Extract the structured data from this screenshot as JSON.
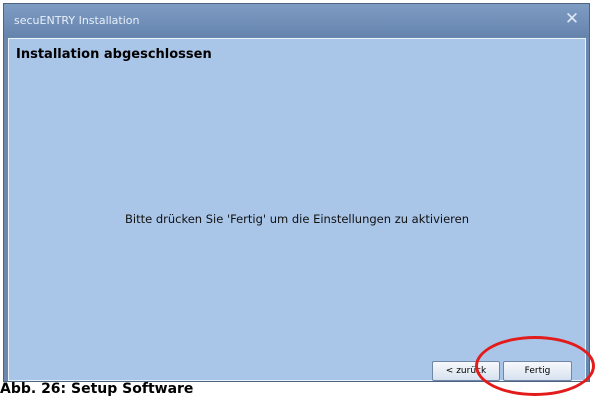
{
  "window": {
    "title": "secuENTRY Installation",
    "close_symbol": "✕"
  },
  "content": {
    "heading": "Installation abgeschlossen",
    "message": "Bitte drücken Sie 'Fertig' um die Einstellungen zu aktivieren"
  },
  "buttons": {
    "back_label": "< zurück",
    "finish_label": "Fertig"
  },
  "caption": "Abb. 26: Setup Software",
  "icons": {
    "close": "close-icon"
  },
  "colors": {
    "window_frame": "#6a87ad",
    "content_bg": "#a9c5e8",
    "highlight": "#e31b1b"
  }
}
